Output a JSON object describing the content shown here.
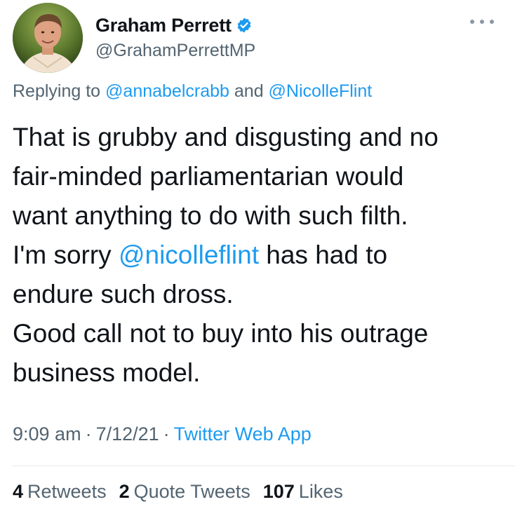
{
  "author": {
    "display_name": "Graham Perrett",
    "handle": "@GrahamPerrettMP",
    "verified_icon": "verified-badge-icon",
    "verified_color": "#1d9bf0"
  },
  "reply": {
    "prefix": "Replying to ",
    "mention_1": "@annabelcrabb",
    "conjunction": " and ",
    "mention_2": "@NicolleFlint"
  },
  "tweet": {
    "line_1": "That is grubby and disgusting and no",
    "line_2": "fair-minded parliamentarian would",
    "line_3": "want anything to do with such filth.",
    "line_4_prefix": "I'm sorry ",
    "line_4_mention": "@nicolleflint",
    "line_4_suffix": " has had to",
    "line_5": "endure such dross.",
    "line_6": "Good call not to buy into his outrage",
    "line_7": "business model."
  },
  "meta": {
    "time": "9:09 am",
    "separator": "·",
    "date": "7/12/21",
    "source": "Twitter Web App"
  },
  "stats": {
    "retweets_count": "4",
    "retweets_label": "Retweets",
    "quotes_count": "2",
    "quotes_label": "Quote Tweets",
    "likes_count": "107",
    "likes_label": "Likes"
  },
  "colors": {
    "link": "#1d9bf0",
    "muted": "#536471",
    "text": "#0f1419"
  }
}
